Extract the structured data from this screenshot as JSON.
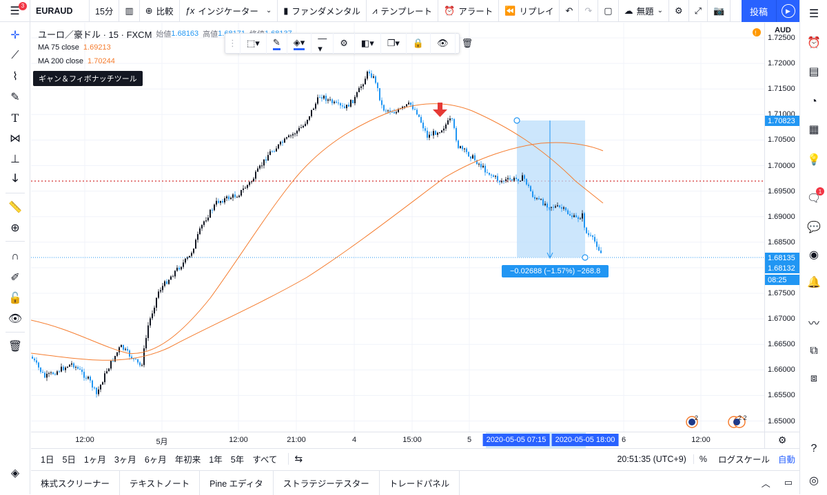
{
  "topbar": {
    "symbol": "EURAUD",
    "interval": "15分",
    "compare": "比較",
    "indicators": "インジケーター",
    "fundamentals": "ファンダメンタル",
    "templates": "テンプレート",
    "alert": "アラート",
    "replay": "リプレイ",
    "layout": "無題",
    "publish": "投稿",
    "badge": "3"
  },
  "legend": {
    "title": "ユーロ／豪ドル · 15 · FXCM",
    "open_label": "始値",
    "open_value": "1.68163",
    "high_label": "高値",
    "high_value": "1.68171",
    "close_label": "終値",
    "close_value": "1.68137",
    "ma1_label": "MA 75 close",
    "ma1_value": "1.69213",
    "ma2_label": "MA 200 close",
    "ma2_value": "1.70244"
  },
  "tooltip": "ギャン＆フィボナッチツール",
  "price_axis": {
    "currency": "AUD",
    "ticks": [
      "1.72500",
      "1.72000",
      "1.71500",
      "1.71000",
      "1.70500",
      "1.70000",
      "1.69500",
      "1.69000",
      "1.68500",
      "1.68000",
      "1.67500",
      "1.67000",
      "1.66500",
      "1.66000",
      "1.65500",
      "1.65000"
    ],
    "tag_top": "1.70823",
    "tag_close": "1.68135",
    "tag_close2": "1.68132",
    "tag_countdown": "08:25"
  },
  "time_axis": {
    "ticks": [
      "12:00",
      "5月",
      "12:00",
      "21:00",
      "4",
      "15:00",
      "5",
      "6",
      "12:00"
    ],
    "tag_start": "2020-05-05   07:15",
    "tag_end": "2020-05-05   18:00"
  },
  "measure": {
    "label": "−0.02688 (−1.57%) −268.8"
  },
  "bottom_range": {
    "ranges": [
      "1日",
      "5日",
      "1ヶ月",
      "3ヶ月",
      "6ヶ月",
      "年初来",
      "1年",
      "5年",
      "すべて"
    ],
    "clock": "20:51:35 (UTC+9)",
    "percent": "%",
    "log": "ログスケール",
    "auto": "自動"
  },
  "bottom_tabs": [
    "株式スクリーナー",
    "テキストノート",
    "Pine エディタ",
    "ストラテジーテスター",
    "トレードパネル"
  ],
  "right_badge": "1",
  "colors": {
    "accent": "#2962ff",
    "ma": "#f57c2e",
    "candle": "#2196f3",
    "measure_fill": "#bbdefb",
    "hline": "#d32f2f"
  }
}
